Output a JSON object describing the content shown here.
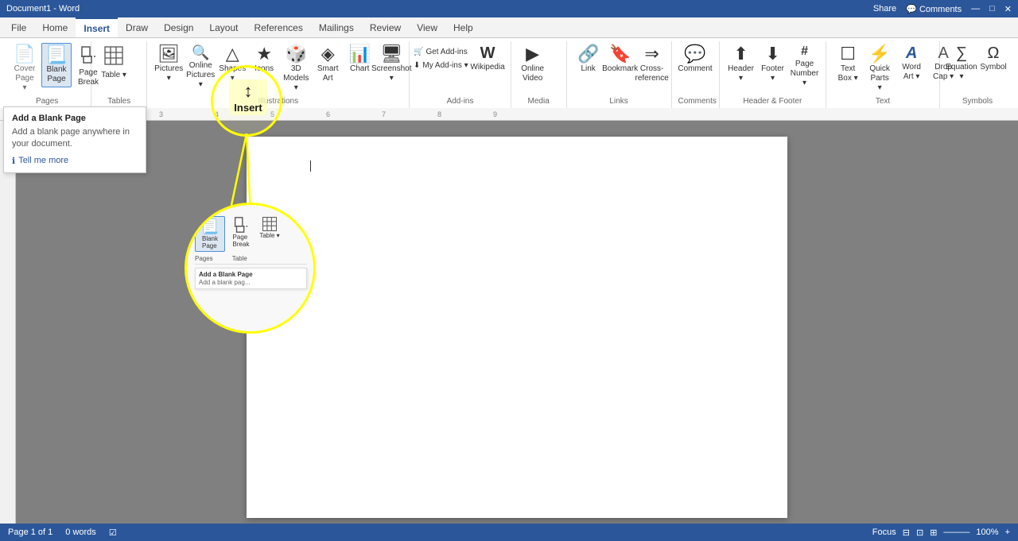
{
  "titleBar": {
    "appName": "Document1 - Word",
    "shareLabel": "Share",
    "commentsLabel": "Comments"
  },
  "ribbonTabs": [
    {
      "id": "file",
      "label": "File"
    },
    {
      "id": "home",
      "label": "Home"
    },
    {
      "id": "insert",
      "label": "Insert",
      "active": true
    },
    {
      "id": "draw",
      "label": "Draw"
    },
    {
      "id": "design",
      "label": "Design"
    },
    {
      "id": "layout",
      "label": "Layout"
    },
    {
      "id": "references",
      "label": "References"
    },
    {
      "id": "mailings",
      "label": "Mailings"
    },
    {
      "id": "review",
      "label": "Review"
    },
    {
      "id": "view",
      "label": "View"
    },
    {
      "id": "help",
      "label": "Help"
    }
  ],
  "ribbon": {
    "groups": {
      "pages": {
        "label": "Pages",
        "buttons": [
          {
            "id": "cover",
            "icon": "📄",
            "label": "Cover\nPage",
            "hasDropdown": true
          },
          {
            "id": "blank",
            "icon": "📃",
            "label": "Blank\nPage",
            "active": true
          },
          {
            "id": "pagebreak",
            "icon": "⊟",
            "label": "Page\nBreak"
          }
        ]
      },
      "tables": {
        "label": "Tables",
        "buttons": [
          {
            "id": "table",
            "icon": "⊞",
            "label": "Table",
            "hasDropdown": true
          }
        ]
      },
      "illustrations": {
        "label": "Illustrations",
        "buttons": [
          {
            "id": "pictures",
            "icon": "🖼",
            "label": "Pictures",
            "hasDropdown": true
          },
          {
            "id": "online-pictures",
            "icon": "🔍",
            "label": "Online\nPictures",
            "hasDropdown": true
          },
          {
            "id": "shapes",
            "icon": "△",
            "label": "Shapes",
            "hasDropdown": true
          },
          {
            "id": "icons",
            "icon": "★",
            "label": "Icons"
          },
          {
            "id": "3d-models",
            "icon": "🎲",
            "label": "3D\nModels",
            "hasDropdown": true
          },
          {
            "id": "smartart",
            "icon": "◈",
            "label": "Smart\nArt"
          },
          {
            "id": "chart",
            "icon": "📊",
            "label": "Chart"
          },
          {
            "id": "screenshot",
            "icon": "🖥",
            "label": "Screenshot",
            "hasDropdown": true
          }
        ]
      },
      "addins": {
        "label": "Add-ins",
        "buttons": [
          {
            "id": "get-addins",
            "icon": "🛒",
            "label": "Get Add-ins"
          },
          {
            "id": "my-addins",
            "icon": "⬇",
            "label": "My Add-ins",
            "hasDropdown": true
          },
          {
            "id": "wikipedia",
            "icon": "W",
            "label": "Wikipedia"
          }
        ]
      },
      "media": {
        "label": "Media",
        "buttons": [
          {
            "id": "online-video",
            "icon": "▶",
            "label": "Online\nVideo"
          }
        ]
      },
      "links": {
        "label": "Links",
        "buttons": [
          {
            "id": "link",
            "icon": "🔗",
            "label": "Link"
          },
          {
            "id": "bookmark",
            "icon": "🔖",
            "label": "Bookmark"
          },
          {
            "id": "cross-ref",
            "icon": "⇒",
            "label": "Cross-\nreference"
          }
        ]
      },
      "comments": {
        "label": "Comments",
        "buttons": [
          {
            "id": "comment",
            "icon": "💬",
            "label": "Comment"
          }
        ]
      },
      "headerfooter": {
        "label": "Header & Footer",
        "buttons": [
          {
            "id": "header",
            "icon": "⬆",
            "label": "Header",
            "hasDropdown": true
          },
          {
            "id": "footer",
            "icon": "⬇",
            "label": "Footer",
            "hasDropdown": true
          },
          {
            "id": "page-number",
            "icon": "#",
            "label": "Page\nNumber",
            "hasDropdown": true
          }
        ]
      },
      "text": {
        "label": "Text",
        "buttons": [
          {
            "id": "textbox",
            "icon": "☐",
            "label": "Text\nBox",
            "hasDropdown": true
          },
          {
            "id": "quick-parts",
            "icon": "⚡",
            "label": "Quick\nParts",
            "hasDropdown": true
          },
          {
            "id": "wordart",
            "icon": "A",
            "label": "Word\nArt",
            "hasDropdown": true
          },
          {
            "id": "drop-cap",
            "icon": "A",
            "label": "Drop\nCap",
            "hasDropdown": true
          }
        ]
      },
      "symbols": {
        "label": "Symbols",
        "buttons": [
          {
            "id": "equation",
            "icon": "Ω",
            "label": "Equation",
            "hasDropdown": true
          },
          {
            "id": "symbol",
            "icon": "Ω",
            "label": "Symbol"
          }
        ]
      }
    }
  },
  "tooltip": {
    "title": "Add a Blank Page",
    "description": "Add a blank page anywhere in your document.",
    "linkText": "Tell me more"
  },
  "zoomTooltip": {
    "title": "Add a Blank Page",
    "description": "Add a blank pag..."
  },
  "statusBar": {
    "page": "Page 1 of 1",
    "words": "0 words"
  },
  "icons": {
    "search": "🔍",
    "info": "ℹ",
    "share": "📤",
    "comment": "💬"
  }
}
